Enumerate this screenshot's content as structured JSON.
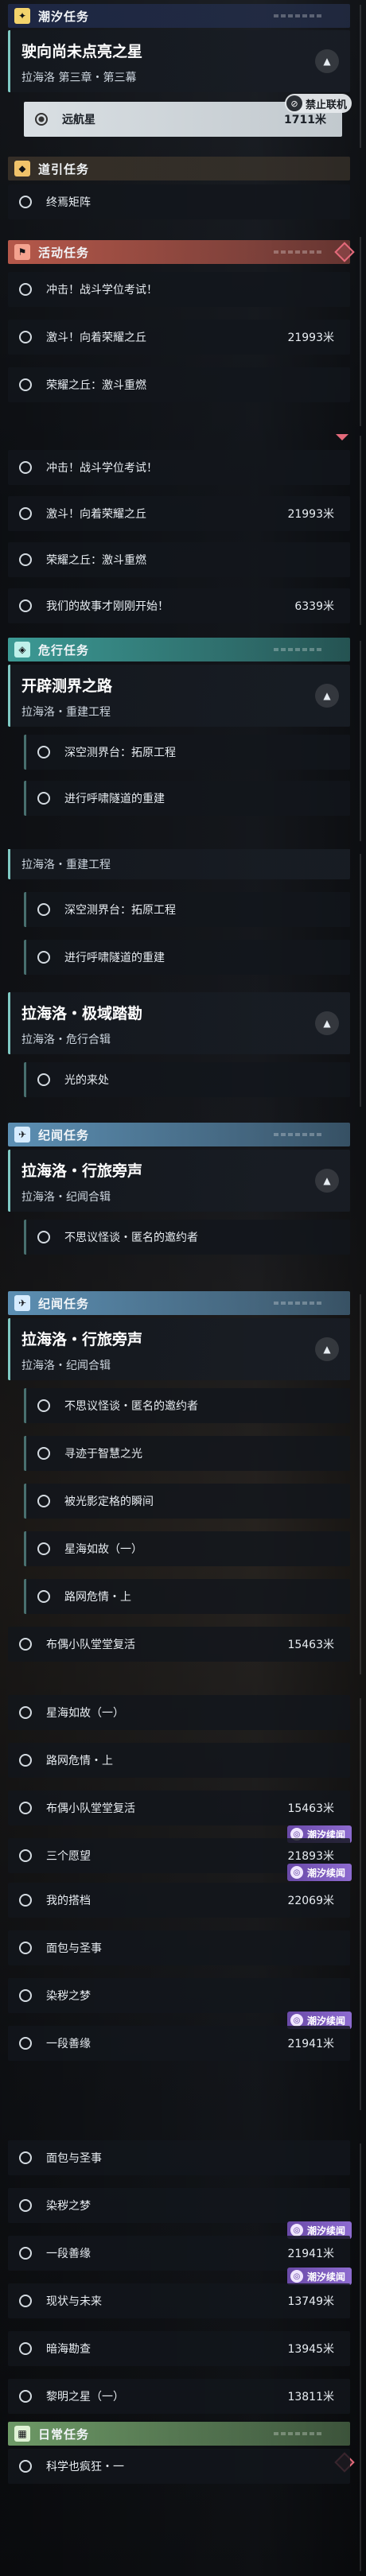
{
  "categories": {
    "chaoxi": "潮汐任务",
    "daoyin": "道引任务",
    "huodong": "活动任务",
    "weixing": "危行任务",
    "jiwen": "纪闻任务",
    "richang": "日常任务"
  },
  "icons": {
    "chaoxi": "✦",
    "daoyin": "⬥",
    "huodong": "⚑",
    "weixing": "◈",
    "jiwen": "✈",
    "richang": "▦",
    "expand": "▲",
    "badge": "◎",
    "stop": "⊘"
  },
  "colors": {
    "chaoxi": "#2d3a5c",
    "huodong": "#b5584a",
    "weixing": "#3c9a95",
    "jiwen": "#5c8fb3",
    "richang": "#6d9966",
    "badge": "#7a58bd",
    "warning": "#e46a7b"
  },
  "quests": {
    "tide_main": {
      "title": "驶向尚未点亮之星",
      "subtitle": "拉海洛 第三章・第三幕"
    },
    "far_ship": {
      "name": "远航星",
      "distance": "1711米"
    },
    "terminal": "终焉矩阵",
    "impact": "冲击！战斗学位考试！",
    "torrent": {
      "name": "激斗！向着荣耀之丘",
      "distance": "21993米"
    },
    "glory": "荣耀之丘：激斗重燃",
    "story": {
      "name": "我们的故事才刚刚开始！",
      "distance": "6339米"
    },
    "pioneer": {
      "title": "开辟测界之路",
      "subtitle": "拉海洛・重建工程"
    },
    "deep_space": "深空测界台：拓原工程",
    "tunnel": "进行呼啸隧道的重建",
    "realm": {
      "title": "拉海洛・极域踏勘",
      "subtitle": "拉海洛・危行合辑"
    },
    "light": "光的来处",
    "journey": {
      "title": "拉海洛・行旅旁声",
      "subtitle": "拉海洛・纪闻合辑"
    },
    "weird": "不思议怪谈・匿名的邀约者",
    "wisdom": "寻迹于智慧之光",
    "moment": "被光影定格的瞬间",
    "starsea_one": "星海如故（一）",
    "road": "路网危情・上",
    "doll": {
      "name": "布偶小队堂堂复活",
      "distance": "15463米"
    },
    "three_wishes": {
      "name": "三个愿望",
      "distance": "21893米"
    },
    "my_partner": {
      "name": "我的搭档",
      "distance": "22069米"
    },
    "bread": "面包与圣事",
    "dye": "染秽之梦",
    "ritual": {
      "name": "一段善缘",
      "distance": "21941米"
    },
    "reality": {
      "name": "现状与未来",
      "distance": "13749米"
    },
    "dark": {
      "name": "暗海勘查",
      "distance": "13945米"
    },
    "dawn": {
      "name": "黎明之星（一）",
      "distance": "13811米"
    },
    "science": "科学也疯狂・一"
  },
  "badge_label": "潮汐续闻",
  "stop_label": "禁止联机"
}
